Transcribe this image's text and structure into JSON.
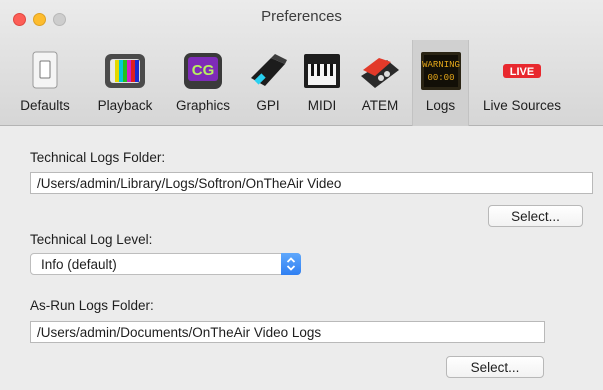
{
  "window": {
    "title": "Preferences"
  },
  "toolbar": {
    "items": [
      {
        "label": "Defaults",
        "icon": "switch-icon"
      },
      {
        "label": "Playback",
        "icon": "tv-icon"
      },
      {
        "label": "Graphics",
        "icon": "cg-icon"
      },
      {
        "label": "GPI",
        "icon": "gpi-connector-icon"
      },
      {
        "label": "MIDI",
        "icon": "midi-keyboard-icon"
      },
      {
        "label": "ATEM",
        "icon": "atem-switcher-icon"
      },
      {
        "label": "Logs",
        "icon": "logs-display-icon",
        "selected": true,
        "display_text": "WARNING"
      },
      {
        "label": "Live Sources",
        "icon": "live-badge-icon",
        "badge_text": "LIVE"
      }
    ]
  },
  "technical_logs": {
    "folder_label": "Technical Logs Folder:",
    "folder_value": "/Users/admin/Library/Logs/Softron/OnTheAir Video",
    "select_label": "Select...",
    "level_label": "Technical Log Level:",
    "level_value": "Info (default)"
  },
  "as_run_logs": {
    "folder_label": "As-Run Logs Folder:",
    "folder_value": "/Users/admin/Documents/OnTheAir Video Logs",
    "select_label": "Select..."
  },
  "colors": {
    "accent": "#2f7ff2",
    "live_red": "#e8282e"
  }
}
